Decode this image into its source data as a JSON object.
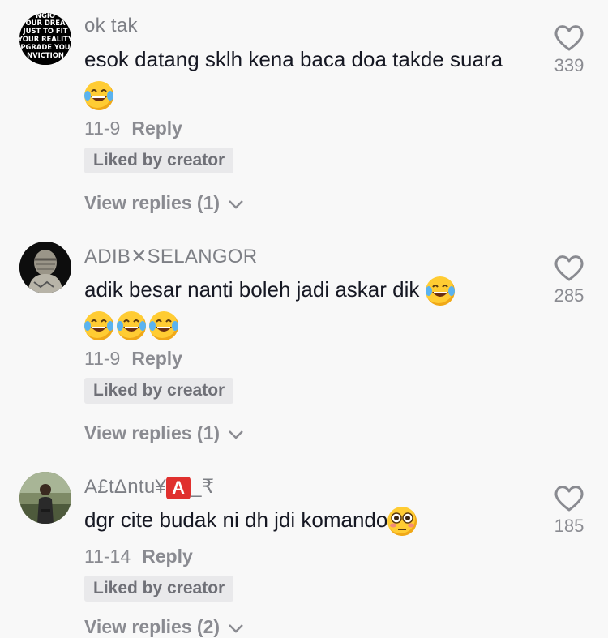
{
  "comments": [
    {
      "username": "ok tak",
      "text": "esok datang sklh kena baca doa takde suara",
      "emoji_suffix": [
        "joy-emoji"
      ],
      "date": "11-9",
      "reply_label": "Reply",
      "badge": "Liked by creator",
      "view_replies": "View replies (1)",
      "likes": "339",
      "avatar_text": [
        "NGIO",
        "OUR DREA",
        "JUST TO FIT",
        "YOUR REALITY",
        "PGRADE YOU",
        "NVICTION"
      ]
    },
    {
      "username": "ADIB✕SELANGOR",
      "text": "adik besar nanti boleh jadi askar dik",
      "emoji_suffix": [
        "joy-emoji",
        "joy-emoji",
        "joy-emoji",
        "joy-emoji"
      ],
      "date": "11-9",
      "reply_label": "Reply",
      "badge": "Liked by creator",
      "view_replies": "View replies (1)",
      "likes": "285"
    },
    {
      "username_prefix": "A£tΔntu¥",
      "username_badge": "A",
      "username_suffix": "_₹",
      "text": "dgr cite budak ni dh jdi komando",
      "emoji_suffix": [
        "flushed-emoji"
      ],
      "date": "11-14",
      "reply_label": "Reply",
      "badge": "Liked by creator",
      "view_replies": "View replies (2)",
      "likes": "185"
    }
  ],
  "colors": {
    "background": "#f8f8f8",
    "text": "#161823",
    "muted": "#8a8b91",
    "badge_bg": "#e9e9eb"
  }
}
